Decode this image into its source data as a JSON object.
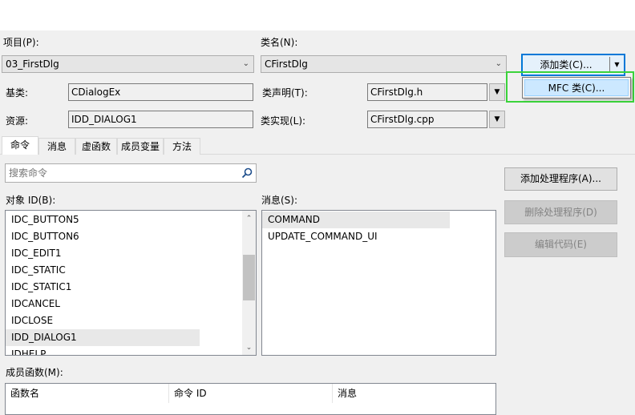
{
  "top": {
    "project_label": "项目(P):",
    "project_value": "03_FirstDlg",
    "classname_label": "类名(N):",
    "classname_value": "CFirstDlg",
    "add_class_label": "添加类(C)...",
    "mfc_class_label": "MFC 类(C)...",
    "base_label": "基类:",
    "base_value": "CDialogEx",
    "resource_label": "资源:",
    "resource_value": "IDD_DIALOG1",
    "decl_label": "类声明(T):",
    "decl_value": "CFirstDlg.h",
    "impl_label": "类实现(L):",
    "impl_value": "CFirstDlg.cpp"
  },
  "tabs": [
    {
      "label": "命令"
    },
    {
      "label": "消息"
    },
    {
      "label": "虚函数"
    },
    {
      "label": "成员变量"
    },
    {
      "label": "方法"
    }
  ],
  "commands": {
    "search_placeholder": "搜索命令",
    "object_id_label": "对象 ID(B):",
    "object_ids": [
      "IDC_BUTTON5",
      "IDC_BUTTON6",
      "IDC_EDIT1",
      "IDC_STATIC",
      "IDC_STATIC1",
      "IDCANCEL",
      "IDCLOSE",
      "IDD_DIALOG1",
      "IDHELP"
    ],
    "messages_label": "消息(S):",
    "messages": [
      "COMMAND",
      "UPDATE_COMMAND_UI"
    ],
    "add_handler_label": "添加处理程序(A)...",
    "delete_handler_label": "删除处理程序(D)",
    "edit_code_label": "编辑代码(E)",
    "member_functions_label": "成员函数(M):",
    "columns": [
      "函数名",
      "命令 ID",
      "消息"
    ]
  },
  "colors": {
    "focus_blue": "#0078d7",
    "highlight_green": "#3ad33a",
    "menu_item_bg": "#cce8ff"
  }
}
